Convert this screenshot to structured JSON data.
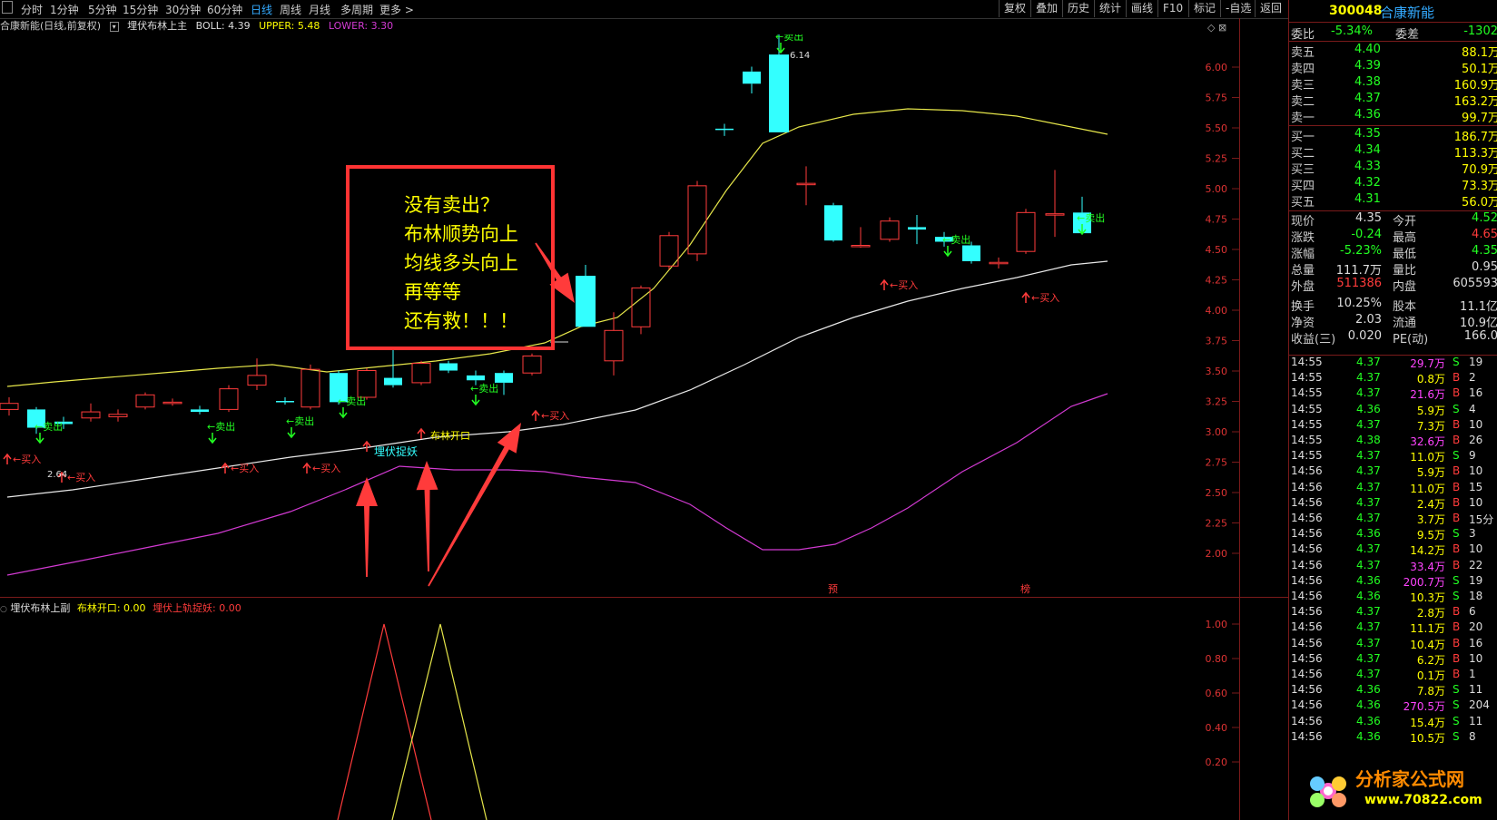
{
  "toolbar": {
    "periods": [
      "分时",
      "1分钟",
      "5分钟",
      "15分钟",
      "30分钟",
      "60分钟",
      "日线",
      "周线",
      "月线",
      "多周期",
      "更多 >"
    ],
    "active_period": "日线",
    "right_buttons": [
      "复权",
      "叠加",
      "历史",
      "统计",
      "画线",
      "F10",
      "标记",
      "-自选",
      "返回"
    ]
  },
  "main_title": {
    "stock": "合康新能(日线,前复权)",
    "indicator": "埋伏布林上主",
    "boll": "BOLL: 4.39",
    "upper": "UPPER: 5.48",
    "lower": "LOWER: 3.30"
  },
  "sub_title": {
    "indicator": "埋伏布林上副",
    "open": "布林开口: 0.00",
    "catch": "埋伏上轨捉妖: 0.00"
  },
  "y_axis_main": [
    "6.00",
    "5.75",
    "5.50",
    "5.25",
    "5.00",
    "4.75",
    "4.50",
    "4.25",
    "4.00",
    "3.75",
    "3.50",
    "3.25",
    "3.00",
    "2.75",
    "2.50",
    "2.25",
    "2.00"
  ],
  "y_axis_sub": [
    "1.00",
    "0.80",
    "0.60",
    "0.40",
    "0.20"
  ],
  "annotation": {
    "lines": [
      "没有卖出？",
      "布林顺势向上",
      "均线多头向上",
      "再等等",
      "还有救！！！"
    ]
  },
  "chart_labels": {
    "sell": "←卖出",
    "buy": "←买入",
    "buy_plain": "买入",
    "high": "6.14",
    "low": "2.64",
    "ambush": "埋伏捉妖",
    "bollopen": "布林开口",
    "marker_yu": "预",
    "marker_bang": "榜"
  },
  "quote_panel": {
    "code": "300048",
    "name": "合康新能",
    "weibi_label": "委比",
    "weibi": "-5.34%",
    "weicha_label": "委差",
    "weicha": "-1302",
    "asks": [
      {
        "label": "卖五",
        "price": "4.40",
        "vol": "88.1万"
      },
      {
        "label": "卖四",
        "price": "4.39",
        "vol": "50.1万"
      },
      {
        "label": "卖三",
        "price": "4.38",
        "vol": "160.9万"
      },
      {
        "label": "卖二",
        "price": "4.37",
        "vol": "163.2万"
      },
      {
        "label": "卖一",
        "price": "4.36",
        "vol": "99.7万"
      }
    ],
    "bids": [
      {
        "label": "买一",
        "price": "4.35",
        "vol": "186.7万"
      },
      {
        "label": "买二",
        "price": "4.34",
        "vol": "113.3万"
      },
      {
        "label": "买三",
        "price": "4.33",
        "vol": "70.9万"
      },
      {
        "label": "买四",
        "price": "4.32",
        "vol": "73.3万"
      },
      {
        "label": "买五",
        "price": "4.31",
        "vol": "56.0万"
      }
    ],
    "stats": [
      {
        "l1": "现价",
        "v1": "4.35",
        "l2": "今开",
        "v2": "4.52"
      },
      {
        "l1": "涨跌",
        "v1": "-0.24",
        "l2": "最高",
        "v2": "4.65"
      },
      {
        "l1": "涨幅",
        "v1": "-5.23%",
        "l2": "最低",
        "v2": "4.35"
      },
      {
        "l1": "总量",
        "v1": "111.7万",
        "l2": "量比",
        "v2": "0.95"
      },
      {
        "l1": "外盘",
        "v1": "511386",
        "l2": "内盘",
        "v2": "605593"
      },
      {
        "l1": "换手",
        "v1": "10.25%",
        "l2": "股本",
        "v2": "11.1亿"
      },
      {
        "l1": "净资",
        "v1": "2.03",
        "l2": "流通",
        "v2": "10.9亿"
      },
      {
        "l1": "收益(三)",
        "v1": "0.020",
        "l2": "PE(动)",
        "v2": "166.0"
      }
    ],
    "ticks": [
      {
        "t": "14:55",
        "p": "4.37",
        "v": "29.7万",
        "s": "S",
        "n": "19"
      },
      {
        "t": "14:55",
        "p": "4.37",
        "v": "0.8万",
        "s": "B",
        "n": "2"
      },
      {
        "t": "14:55",
        "p": "4.37",
        "v": "21.6万",
        "s": "B",
        "n": "16"
      },
      {
        "t": "14:55",
        "p": "4.36",
        "v": "5.9万",
        "s": "S",
        "n": "4"
      },
      {
        "t": "14:55",
        "p": "4.37",
        "v": "7.3万",
        "s": "B",
        "n": "10"
      },
      {
        "t": "14:55",
        "p": "4.38",
        "v": "32.6万",
        "s": "B",
        "n": "26"
      },
      {
        "t": "14:55",
        "p": "4.37",
        "v": "11.0万",
        "s": "S",
        "n": "9"
      },
      {
        "t": "14:56",
        "p": "4.37",
        "v": "5.9万",
        "s": "B",
        "n": "10"
      },
      {
        "t": "14:56",
        "p": "4.37",
        "v": "11.0万",
        "s": "B",
        "n": "15"
      },
      {
        "t": "14:56",
        "p": "4.37",
        "v": "2.4万",
        "s": "B",
        "n": "10"
      },
      {
        "t": "14:56",
        "p": "4.37",
        "v": "3.7万",
        "s": "B",
        "n": "15分"
      },
      {
        "t": "14:56",
        "p": "4.36",
        "v": "9.5万",
        "s": "S",
        "n": "3"
      },
      {
        "t": "14:56",
        "p": "4.37",
        "v": "14.2万",
        "s": "B",
        "n": "10"
      },
      {
        "t": "14:56",
        "p": "4.37",
        "v": "33.4万",
        "s": "B",
        "n": "22"
      },
      {
        "t": "14:56",
        "p": "4.36",
        "v": "200.7万",
        "s": "S",
        "n": "19"
      },
      {
        "t": "14:56",
        "p": "4.36",
        "v": "10.3万",
        "s": "S",
        "n": "18"
      },
      {
        "t": "14:56",
        "p": "4.37",
        "v": "2.8万",
        "s": "B",
        "n": "6"
      },
      {
        "t": "14:56",
        "p": "4.37",
        "v": "11.1万",
        "s": "B",
        "n": "20"
      },
      {
        "t": "14:56",
        "p": "4.37",
        "v": "10.4万",
        "s": "B",
        "n": "16"
      },
      {
        "t": "14:56",
        "p": "4.37",
        "v": "6.2万",
        "s": "B",
        "n": "10"
      },
      {
        "t": "14:56",
        "p": "4.37",
        "v": "0.1万",
        "s": "B",
        "n": "1"
      },
      {
        "t": "14:56",
        "p": "4.36",
        "v": "7.8万",
        "s": "S",
        "n": "11"
      },
      {
        "t": "14:56",
        "p": "4.36",
        "v": "270.5万",
        "s": "S",
        "n": "204"
      },
      {
        "t": "14:56",
        "p": "4.36",
        "v": "15.4万",
        "s": "S",
        "n": "11"
      },
      {
        "t": "14:56",
        "p": "4.36",
        "v": "10.5万",
        "s": "S",
        "n": "8"
      }
    ]
  },
  "watermark": {
    "brand": "分析家公式网",
    "url": "www.70822.com"
  },
  "colors": {
    "up": "#ff3b3b",
    "down": "#3ff",
    "upper_band": "#e6e64a",
    "mid_band": "#e8e8e8",
    "lower_band": "#d23ad2",
    "grid": "#7a1a1a"
  }
}
